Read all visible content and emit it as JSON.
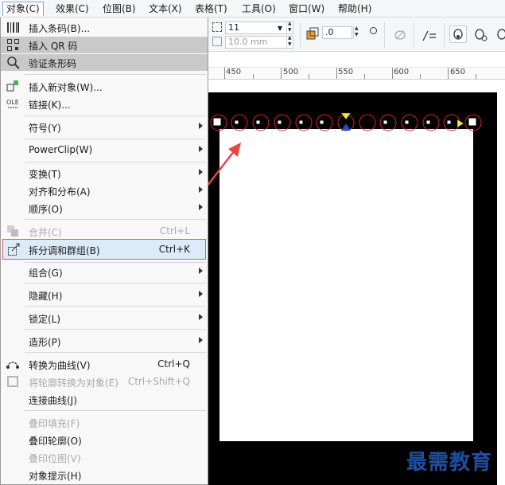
{
  "menubar": {
    "items": [
      {
        "label": "对象(C)",
        "active": true
      },
      {
        "label": "效果(C)"
      },
      {
        "label": "位图(B)"
      },
      {
        "label": "文本(X)"
      },
      {
        "label": "表格(T)"
      },
      {
        "label": "工具(O)"
      },
      {
        "label": "窗口(W)"
      },
      {
        "label": "帮助(H)"
      }
    ]
  },
  "toolbar": {
    "size_value": "11",
    "size_mm": "10.0 mm",
    "offset_value": ".0"
  },
  "ruler": {
    "labels": [
      "450",
      "500",
      "550",
      "600",
      "650"
    ]
  },
  "menu": {
    "items": [
      {
        "label": "插入条码(B)..."
      },
      {
        "label": "插入 QR 码"
      },
      {
        "label": "验证条形码"
      },
      {
        "label": "插入新对象(W)..."
      },
      {
        "label": "链接(K)..."
      },
      {
        "label": "符号(Y)"
      },
      {
        "label": "PowerClip(W)"
      },
      {
        "label": "变换(T)"
      },
      {
        "label": "对齐和分布(A)"
      },
      {
        "label": "顺序(O)"
      },
      {
        "label": "合并(C)",
        "shortcut": "Ctrl+L"
      },
      {
        "label": "拆分调和群组(B)",
        "shortcut": "Ctrl+K"
      },
      {
        "label": "组合(G)"
      },
      {
        "label": "隐藏(H)"
      },
      {
        "label": "锁定(L)"
      },
      {
        "label": "造形(P)"
      },
      {
        "label": "转换为曲线(V)",
        "shortcut": "Ctrl+Q"
      },
      {
        "label": "将轮廓转换为对象(E)",
        "shortcut": "Ctrl+Shift+Q"
      },
      {
        "label": "连接曲线(J)"
      },
      {
        "label": "叠印填充(F)"
      },
      {
        "label": "叠印轮廓(O)"
      },
      {
        "label": "叠印位图(V)"
      },
      {
        "label": "对象提示(H)"
      }
    ]
  },
  "watermark": "最需教育",
  "colors": {
    "highlight_border": "#e25b5b",
    "highlight_bg": "#dcebf8",
    "arrow": "#e84545",
    "watermark": "#1d4fa0"
  }
}
